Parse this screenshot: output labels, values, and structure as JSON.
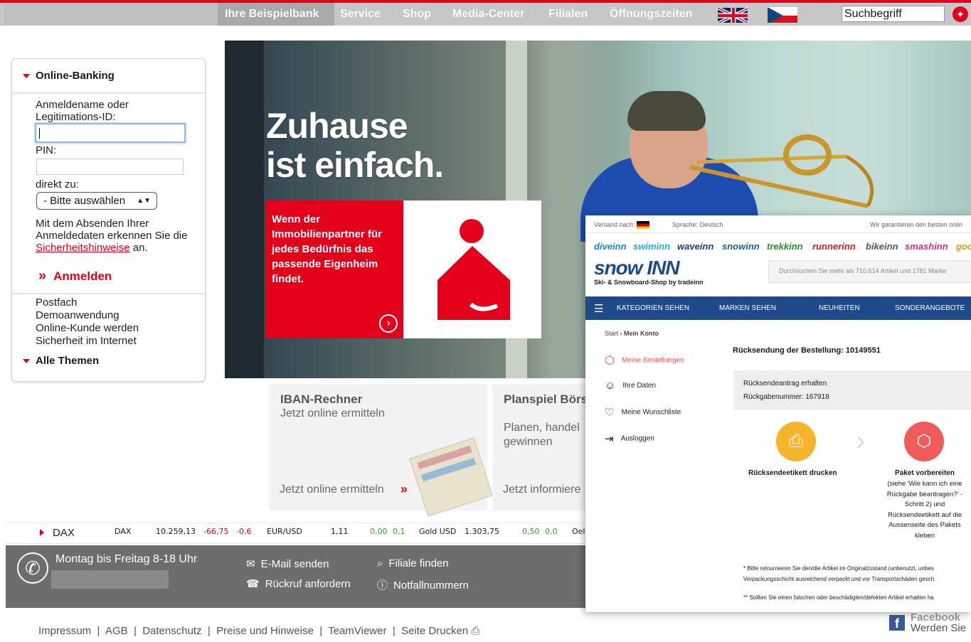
{
  "nav": {
    "active": "Ihre Beispielbank",
    "items": [
      "Service",
      "Shop",
      "Media-Center",
      "Filialen",
      "Öffnungszeiten"
    ],
    "search_value": "Suchbegriff"
  },
  "login": {
    "header": "Online-Banking",
    "username_label": "Anmeldename oder Legitimations-ID:",
    "pin_label": "PIN:",
    "direct_label": "direkt zu:",
    "select_value": "- Bitte auswählen",
    "notice_prefix": "Mit dem Absenden Ihrer Anmeldedaten erkennen Sie die",
    "notice_link": "Sicherheitshinweise",
    "notice_suffix": "an.",
    "submit": "Anmelden",
    "links": [
      "Postfach",
      "Demoanwendung",
      "Online-Kunde werden",
      "Sicherheit im Internet"
    ],
    "all_topics": "Alle Themen"
  },
  "hero": {
    "title_line1": "Zuhause",
    "title_line2": "ist einfach.",
    "promo": "Wenn der Immobilienpartner für jedes Bedürfnis das passende Eigenheim findet."
  },
  "tiles": [
    {
      "title": "IBAN-Rechner",
      "subtitle": "Jetzt online ermitteln",
      "cta": "Jetzt online ermitteln"
    },
    {
      "title": "Planspiel Börs",
      "subtitle": "Planen, handel gewinnen",
      "cta": "Jetzt informiere"
    }
  ],
  "ticker": {
    "label": "DAX",
    "entries": [
      {
        "name": "DAX",
        "value": "10.259,13",
        "change": "-66,75",
        "pct": "-0,6",
        "dir": "down"
      },
      {
        "name": "EUR/USD",
        "value": "1,11",
        "change": "0,00",
        "pct": "0,1",
        "dir": "up"
      },
      {
        "name": "Gold USD",
        "value": "1.303,75",
        "change": "0,50",
        "pct": "0,0",
        "dir": "up"
      },
      {
        "name": "Oel",
        "value": "",
        "change": "",
        "pct": "",
        "dir": ""
      }
    ]
  },
  "contact": {
    "hours": "Montag bis Freitag 8-18 Uhr",
    "email": "E-Mail senden",
    "callback": "Rückruf anfordern",
    "branch": "Filiale finden",
    "emergency": "Notfallnummern"
  },
  "footer_links": [
    "Impressum",
    "AGB",
    "Datenschutz",
    "Preise und Hinweise",
    "TeamViewer",
    "Seite Drucken"
  ],
  "facebook": {
    "line1": "Facebook",
    "line2": "Werden Sie"
  },
  "snowinn": {
    "shipping_to": "Versand nach:",
    "language": "Sprache: Deutsch",
    "guarantee": "Wir garantieren den besten onlin",
    "brands": [
      "diveinn",
      "swiminn",
      "waveinn",
      "snowinn",
      "trekkinn",
      "runnerinn",
      "bikeinn",
      "smashinn",
      "goo"
    ],
    "logo": "snow INN",
    "tagline": "Ski- & Snowboard-Shop by tradeinn",
    "search_placeholder": "Durchsuchen Sie mehr als 710.614 Artikel und 1781 Marke",
    "nav": [
      "KATEGORIEN SEHEN",
      "MARKEN SEHEN",
      "NEUHEITEN",
      "SONDERANGEBOTE"
    ],
    "breadcrumb_start": "Start",
    "breadcrumb_current": "Mein Konto",
    "menu": [
      "Meine Bestellungen",
      "Ihre Daten",
      "Meine Wunschliste",
      "Ausloggen"
    ],
    "return_title": "Rücksendung der Bestellung: 10149551",
    "status_line1": "Rücksendeantrag erhalten",
    "status_line2": "Rückgabenummer: 167918",
    "step1": "Rücksendeetikett drucken",
    "step2_title": "Paket vorbereiten",
    "step2_desc": "(siehe 'Wie kann ich eine Rückgabe beantragen?' - Schritt 2) und Rücksendeetikett auf die Aussenseite des Pakets kleben",
    "note1": "* Bitte retournieren Sie den/die Artikel im Originalzustand (unbenutzt, unbes Verpackungsschicht ausreichend verpackt und vor Transportschäden gesch",
    "note2": "** Sollten Sie einen falschen oder beschädigten/defekten Artikel erhalten ha"
  },
  "colors": {
    "accent": "#e2001a",
    "snow_nav": "#1f4a8a",
    "step1": "#f7b52b",
    "step2": "#ef5a5a"
  }
}
